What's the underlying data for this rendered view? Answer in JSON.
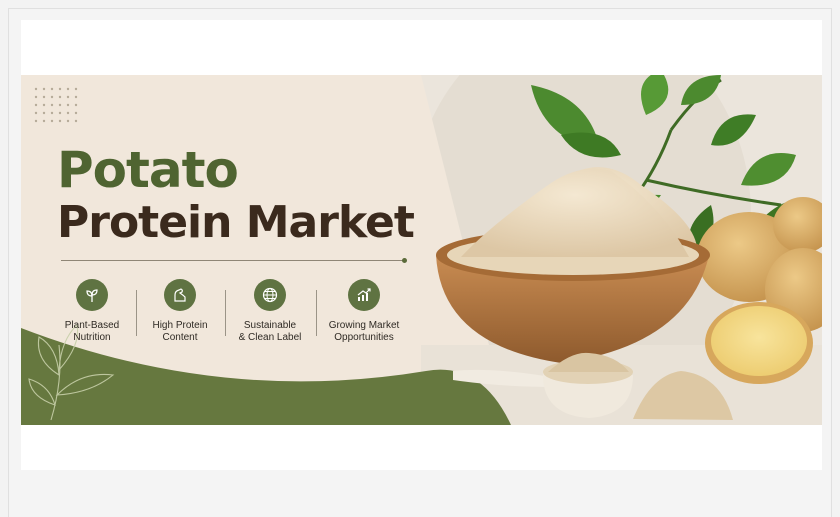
{
  "banner": {
    "title_line1": "Potato",
    "title_line2": "Protein Market",
    "features": [
      {
        "icon": "leaf-icon",
        "line1": "Plant-Based",
        "line2": "Nutrition"
      },
      {
        "icon": "flexed-arm-icon",
        "line1": "High Protein",
        "line2": "Content"
      },
      {
        "icon": "globe-icon",
        "line1": "Sustainable",
        "line2": "& Clean Label"
      },
      {
        "icon": "growth-chart-icon",
        "line1": "Growing Market",
        "line2": "Opportunities"
      }
    ],
    "colors": {
      "title_green": "#4f6431",
      "title_brown": "#3b2a1d",
      "accent_green": "#5f7342",
      "cream_background": "#f1e7db"
    }
  }
}
